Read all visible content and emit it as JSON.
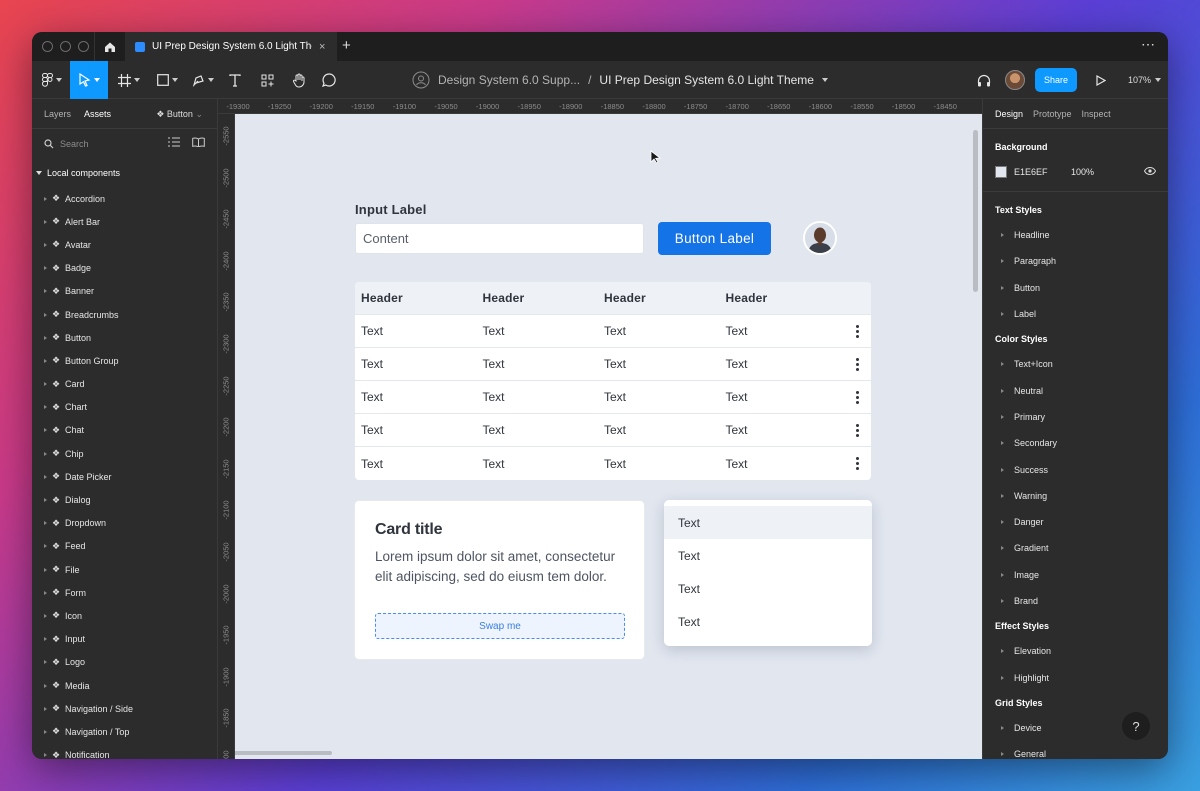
{
  "window": {
    "tab_title": "UI Prep Design System 6.0 Light Theme",
    "tab_close": "×",
    "new_tab": "+",
    "more": "⋯"
  },
  "toolbar": {
    "breadcrumb_project": "Design System 6.0 Supp...",
    "breadcrumb_separator": "/",
    "breadcrumb_file": "UI Prep Design System 6.0 Light Theme",
    "share_label": "Share",
    "zoom_level": "107%"
  },
  "left_panel": {
    "tab_layers": "Layers",
    "tab_assets": "Assets",
    "page_selector": "Button",
    "search_placeholder": "Search",
    "section_title": "Local components",
    "components": [
      "Accordion",
      "Alert Bar",
      "Avatar",
      "Badge",
      "Banner",
      "Breadcrumbs",
      "Button",
      "Button Group",
      "Card",
      "Chart",
      "Chat",
      "Chip",
      "Date Picker",
      "Dialog",
      "Dropdown",
      "Feed",
      "File",
      "Form",
      "Icon",
      "Input",
      "Logo",
      "Media",
      "Navigation / Side",
      "Navigation / Top",
      "Notification"
    ]
  },
  "rulers": {
    "top": [
      "-19300",
      "-19250",
      "-19200",
      "-19150",
      "-19100",
      "-19050",
      "-19000",
      "-18950",
      "-18900",
      "-18850",
      "-18800",
      "-18750",
      "-18700",
      "-18650",
      "-18600",
      "-18550",
      "-18500",
      "-18450"
    ],
    "left": [
      "-2550",
      "-2500",
      "-2450",
      "-2400",
      "-2350",
      "-2300",
      "-2250",
      "-2200",
      "-2150",
      "-2100",
      "-2050",
      "-2000",
      "-1950",
      "-1900",
      "-1850",
      "-1800"
    ]
  },
  "canvas": {
    "input_label": "Input Label",
    "input_value": "Content",
    "button_label": "Button Label",
    "table": {
      "headers": [
        "Header",
        "Header",
        "Header",
        "Header"
      ],
      "rows": [
        [
          "Text",
          "Text",
          "Text",
          "Text"
        ],
        [
          "Text",
          "Text",
          "Text",
          "Text"
        ],
        [
          "Text",
          "Text",
          "Text",
          "Text"
        ],
        [
          "Text",
          "Text",
          "Text",
          "Text"
        ],
        [
          "Text",
          "Text",
          "Text",
          "Text"
        ]
      ]
    },
    "card": {
      "title": "Card title",
      "body": "Lorem ipsum dolor sit amet, consectetur elit adipiscing, sed do eiusm tem dolor.",
      "swap_label": "Swap me"
    },
    "menu_items": [
      "Text",
      "Text",
      "Text",
      "Text"
    ]
  },
  "right_panel": {
    "tab_design": "Design",
    "tab_prototype": "Prototype",
    "tab_inspect": "Inspect",
    "background_heading": "Background",
    "background_hex": "E1E6EF",
    "background_opacity": "100%",
    "background_color": "#E1E6EF",
    "text_styles_heading": "Text Styles",
    "text_styles": [
      "Headline",
      "Paragraph",
      "Button",
      "Label"
    ],
    "color_styles_heading": "Color Styles",
    "color_styles": [
      "Text+Icon",
      "Neutral",
      "Primary",
      "Secondary",
      "Success",
      "Warning",
      "Danger",
      "Gradient",
      "Image",
      "Brand"
    ],
    "effect_styles_heading": "Effect Styles",
    "effect_styles": [
      "Elevation",
      "Highlight"
    ],
    "grid_styles_heading": "Grid Styles",
    "grid_styles": [
      "Device",
      "General"
    ],
    "help": "?"
  },
  "colors": {
    "accent": "#0D99FF",
    "primary_button": "#1473E6",
    "canvas_bg": "#E1E6EF"
  },
  "icons": {
    "home": "home-icon",
    "move_tool": "move-tool-icon",
    "frame_tool": "frame-tool-icon",
    "shape_tool": "rectangle-tool-icon",
    "pen_tool": "pen-tool-icon",
    "text_tool": "text-tool-icon",
    "components": "components-icon",
    "hand_tool": "hand-tool-icon",
    "comment_tool": "comment-tool-icon",
    "headphones": "headphones-icon",
    "present": "play-icon",
    "visibility": "eye-icon"
  }
}
